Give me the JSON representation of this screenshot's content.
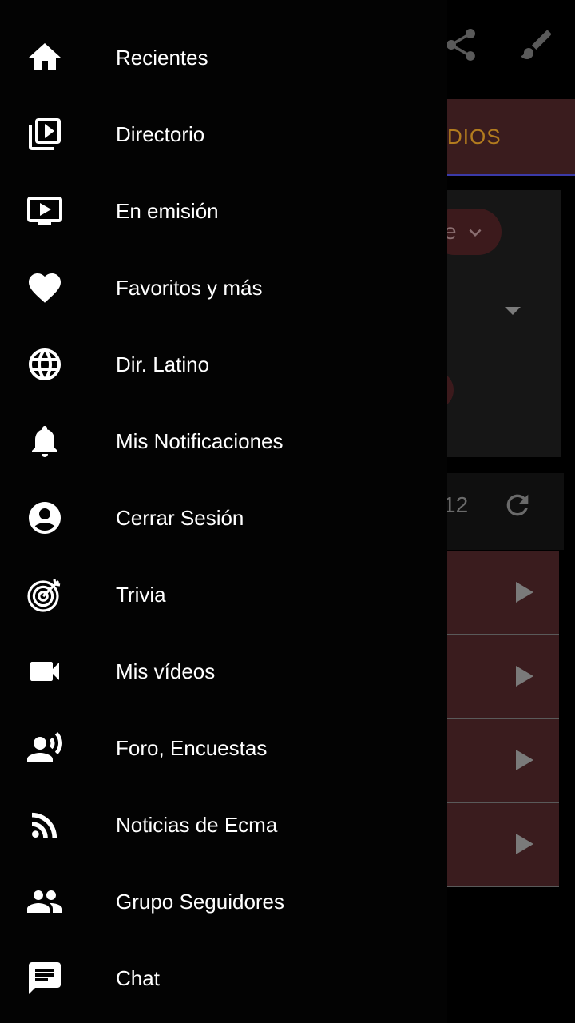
{
  "drawer": {
    "items": [
      {
        "label": "Recientes",
        "icon": "home-icon"
      },
      {
        "label": "Directorio",
        "icon": "video-library-icon"
      },
      {
        "label": "En emisión",
        "icon": "live-tv-icon"
      },
      {
        "label": "Favoritos y más",
        "icon": "heart-icon"
      },
      {
        "label": "Dir. Latino",
        "icon": "globe-icon"
      },
      {
        "label": "Mis Notificaciones",
        "icon": "bell-icon"
      },
      {
        "label": "Cerrar Sesión",
        "icon": "account-circle-icon"
      },
      {
        "label": "Trivia",
        "icon": "target-icon"
      },
      {
        "label": "Mis vídeos",
        "icon": "videocam-icon"
      },
      {
        "label": "Foro, Encuestas",
        "icon": "record-voice-icon"
      },
      {
        "label": "Noticias de Ecma",
        "icon": "rss-feed-icon"
      },
      {
        "label": "Grupo Seguidores",
        "icon": "group-icon"
      },
      {
        "label": "Chat",
        "icon": "chat-icon"
      }
    ]
  },
  "background": {
    "tab_label": "DIOS",
    "dropdown_text": "e",
    "page_number": "12"
  },
  "colors": {
    "drawer_bg": "#030303",
    "accent_tab_text": "#b37c1e",
    "accent_red": "#3a1c1e"
  }
}
